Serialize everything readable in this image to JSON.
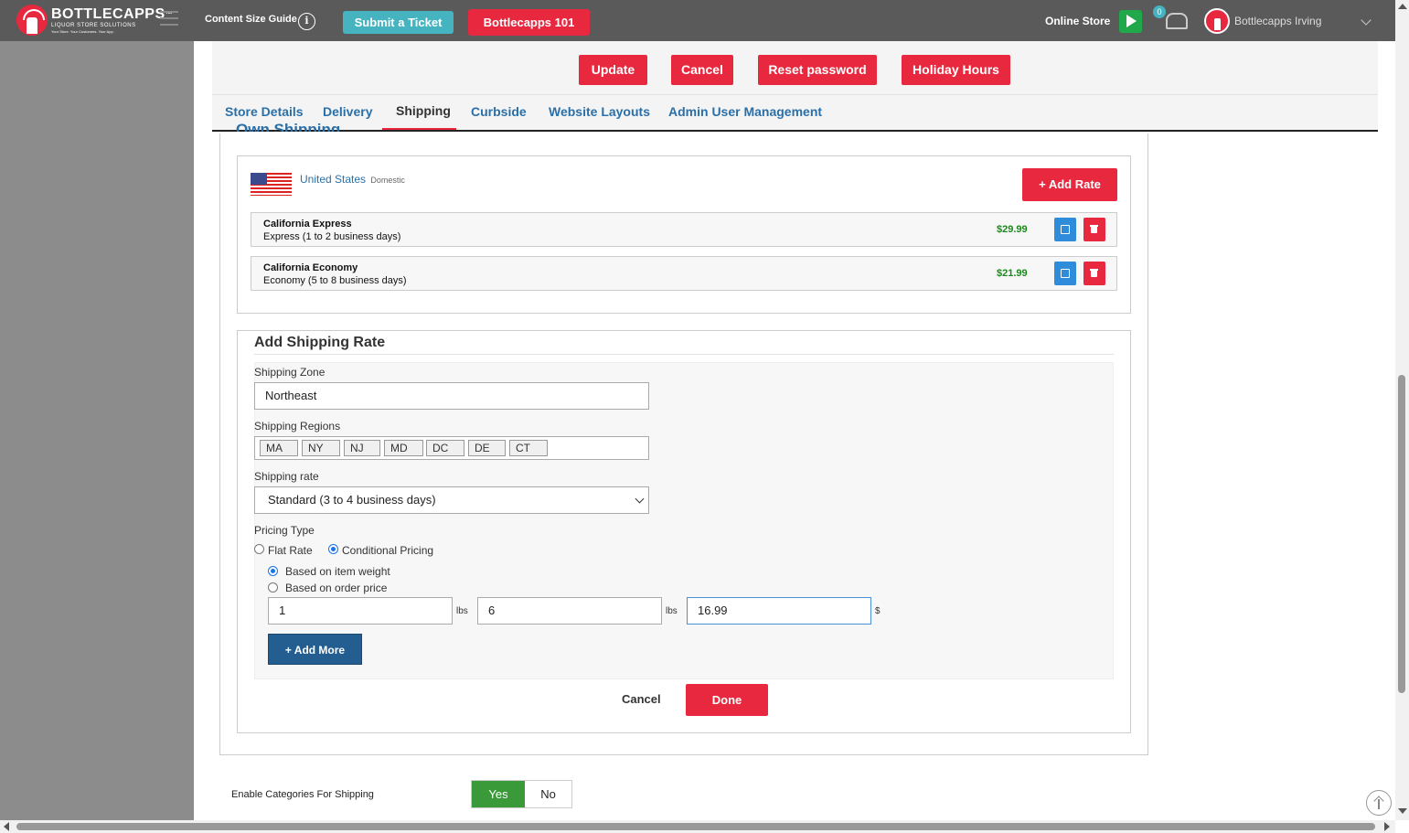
{
  "topbar": {
    "brand": "BOTTLECAPPS",
    "brand_tm": "™",
    "brand_sub": "LIQUOR STORE SOLUTIONS",
    "brand_tag": "Your Store. Your Customers. Your App.",
    "content_size_guide": "Content Size Guide",
    "info_glyph": "i",
    "submit_ticket": "Submit a Ticket",
    "bottlecapps_101": "Bottlecapps 101",
    "online_store": "Online Store",
    "notification_count": "0",
    "user_name": "Bottlecapps Irving"
  },
  "actions": {
    "update": "Update",
    "cancel": "Cancel",
    "reset_password": "Reset password",
    "holiday_hours": "Holiday Hours"
  },
  "tabs": [
    {
      "label": "Store Details"
    },
    {
      "label": "Delivery"
    },
    {
      "label": "Shipping"
    },
    {
      "label": "Curbside"
    },
    {
      "label": "Website Layouts"
    },
    {
      "label": "Admin User Management"
    }
  ],
  "own_shipping": {
    "title": "Own Shipping",
    "country": "United States",
    "country_type": "Domestic",
    "add_rate": "+ Add Rate",
    "rates": [
      {
        "name": "California Express",
        "desc": "Express (1 to 2 business days)",
        "price": "$29.99"
      },
      {
        "name": "California Economy",
        "desc": "Economy (5 to 8 business days)",
        "price": "$21.99"
      }
    ]
  },
  "add_rate_form": {
    "title": "Add Shipping Rate",
    "zone_label": "Shipping Zone",
    "zone_value": "Northeast",
    "regions_label": "Shipping Regions",
    "regions": [
      "MA",
      "NY",
      "NJ",
      "MD",
      "DC",
      "DE",
      "CT"
    ],
    "rate_label": "Shipping rate",
    "rate_value": "Standard (3 to 4 business days)",
    "pricing_type_label": "Pricing Type",
    "flat_rate": "Flat Rate",
    "conditional_pricing": "Conditional Pricing",
    "based_on_weight": "Based on item weight",
    "based_on_price": "Based on order price",
    "min_weight": "1",
    "max_weight": "6",
    "price": "16.99",
    "unit_lbs": "lbs",
    "unit_dollar": "$",
    "add_more": "+ Add More",
    "cancel": "Cancel",
    "done": "Done"
  },
  "enable_categories": {
    "label": "Enable Categories For Shipping",
    "yes": "Yes",
    "no": "No"
  },
  "colors": {
    "brand_red": "#e8283f",
    "topbar": "#5a5a5a",
    "teal": "#45b4c0",
    "link_blue": "#2a6fa8",
    "green": "#3a9a3a"
  }
}
